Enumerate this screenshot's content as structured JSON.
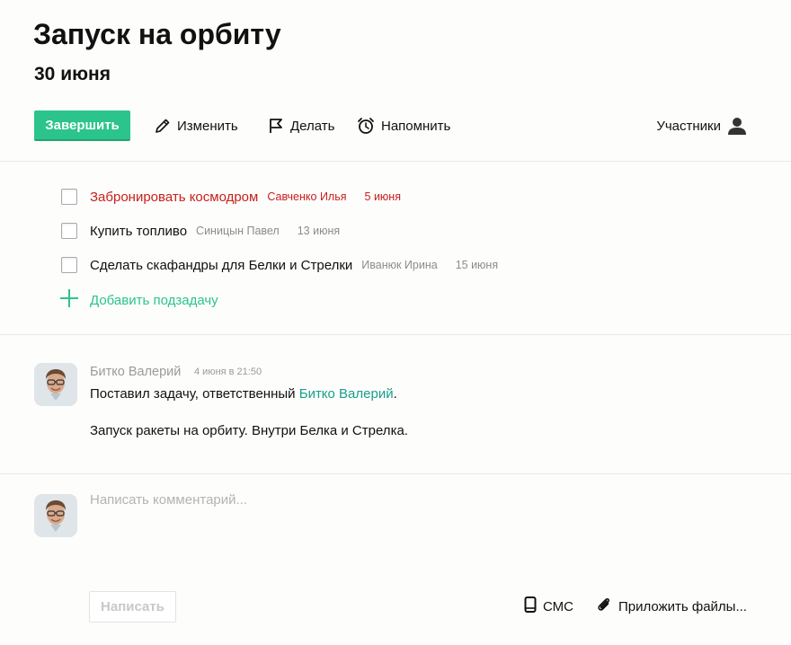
{
  "task": {
    "title": "Запуск на орбиту",
    "date": "30 июня"
  },
  "toolbar": {
    "finish_label": "Завершить",
    "edit_label": "Изменить",
    "do_label": "Делать",
    "remind_label": "Напомнить",
    "members_label": "Участники"
  },
  "subtasks": [
    {
      "title": "Забронировать космодром",
      "assignee": "Савченко Илья",
      "due": "5 июня",
      "overdue": true
    },
    {
      "title": "Купить топливо",
      "assignee": "Синицын Павел",
      "due": "13 июня",
      "overdue": false
    },
    {
      "title": "Сделать скафандры для Белки и Стрелки",
      "assignee": "Иванюк Ирина",
      "due": "15 июня",
      "overdue": false
    }
  ],
  "add_subtask_label": "Добавить подзадачу",
  "comment": {
    "author": "Битко Валерий",
    "time": "4 июня в 21:50",
    "text_prefix": "Поставил задачу, ответственный ",
    "mention": "Битко Валерий",
    "text_suffix": ".",
    "body": "Запуск ракеты на орбиту. Внутри Белка и Стрелка."
  },
  "composer": {
    "placeholder": "Написать комментарий...",
    "submit_label": "Написать",
    "sms_label": "СМС",
    "attach_label": "Приложить файлы..."
  },
  "colors": {
    "accent_green": "#2bc48c",
    "overdue_red": "#c8201c",
    "link_teal": "#18a089"
  },
  "icons": [
    "pencil-icon",
    "flag-icon",
    "alarm-clock-icon",
    "user-icon",
    "plus-icon",
    "phone-icon",
    "paperclip-icon"
  ]
}
